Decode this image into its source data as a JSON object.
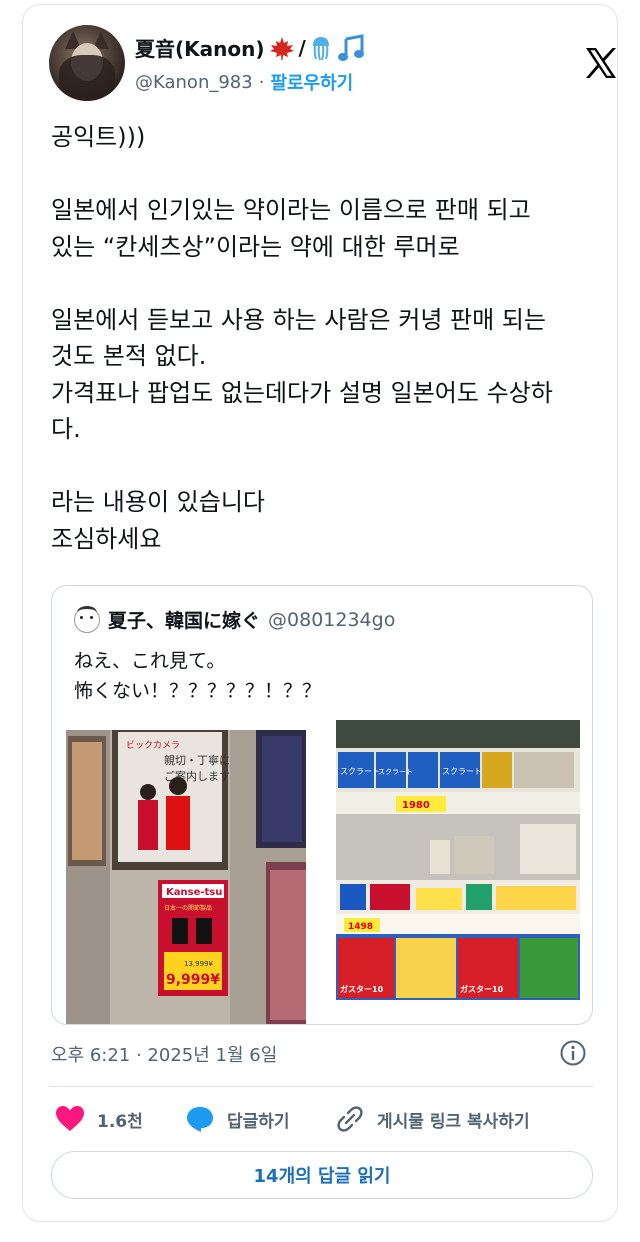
{
  "author": {
    "display_name": "夏音(Kanon)",
    "slash": "/",
    "handle": "@Kanon_983",
    "separator": "·",
    "follow_label": "팔로우하기",
    "name_emoji_icons": [
      "maple-leaf-icon",
      "jellyfish-icon",
      "music-note-icon"
    ]
  },
  "tweet": {
    "lines": [
      "공익트)))",
      "",
      "일본에서 인기있는 약이라는 이름으로 판매 되고",
      "있는 “칸세츠상”이라는 약에 대한 루머로",
      "",
      "일본에서 듣보고 사용 하는 사람은 커녕 판매 되는",
      "것도 본적 없다.",
      "가격표나 팝업도 없는데다가 설명 일본어도 수상하",
      "다.",
      "",
      "라는 내용이 있습니다",
      "조심하세요"
    ]
  },
  "quote": {
    "name": "夏子、韓国に嫁ぐ",
    "handle": "@0801234go",
    "lines": [
      "ねえ、これ見て。",
      "怖くない！？？？？？！？？"
    ],
    "left_image": {
      "poster_brand": "ビックカメラ",
      "poster_lines": [
        "親切・丁寧に",
        "ご案内します"
      ],
      "sign_title": "Kanse-tsu",
      "sign_subtitle": "日本一の関節製品",
      "old_price": "13,999¥",
      "price": "9,999¥"
    },
    "right_image": {
      "product_labels": [
        "スクラート",
        "スクラート",
        "スクラート"
      ],
      "price_tags": [
        "1980",
        "1498"
      ],
      "bottom_labels": [
        "ガスター10",
        "ガスター10"
      ]
    }
  },
  "meta": {
    "timestamp": "오후 6:21 · 2025년 1월 6일"
  },
  "actions": {
    "like_count": "1.6천",
    "reply_label": "답글하기",
    "copy_label": "게시물 링크 복사하기"
  },
  "read_replies_label": "14개의 답글 읽기",
  "colors": {
    "link": "#1d9bf0",
    "heart": "#f91880",
    "reply_bubble": "#1d9bf0",
    "muted": "#536471"
  }
}
